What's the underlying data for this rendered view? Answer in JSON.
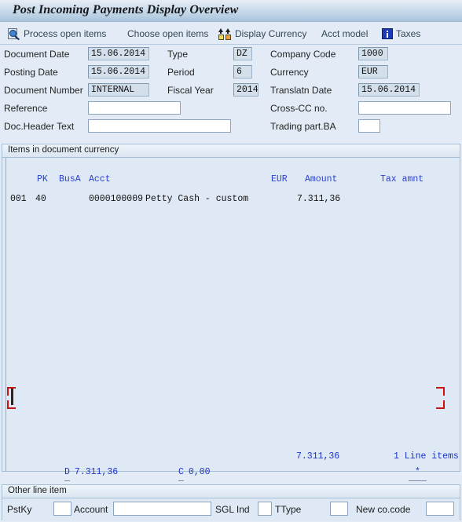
{
  "window": {
    "title": "Post Incoming Payments Display Overview"
  },
  "toolbar": {
    "items": [
      {
        "name": "process-open-items",
        "label": "Process open items",
        "icon": "search-document-icon"
      },
      {
        "name": "choose-open-items",
        "label": "Choose open items",
        "icon": ""
      },
      {
        "name": "display-currency",
        "label": "Display Currency",
        "icon": "two-squares-arrows-icon"
      },
      {
        "name": "acct-model",
        "label": "Acct model",
        "icon": ""
      },
      {
        "name": "taxes",
        "label": "Taxes",
        "icon": "info-icon"
      }
    ]
  },
  "header_form": {
    "document_date": {
      "label": "Document Date",
      "value": "15.06.2014"
    },
    "posting_date": {
      "label": "Posting Date",
      "value": "15.06.2014"
    },
    "document_number": {
      "label": "Document Number",
      "value": "INTERNAL"
    },
    "reference": {
      "label": "Reference",
      "value": "",
      "placeholder": ""
    },
    "doc_header_text": {
      "label": "Doc.Header Text",
      "value": "",
      "placeholder": ""
    },
    "type": {
      "label": "Type",
      "value": "DZ"
    },
    "period": {
      "label": "Period",
      "value": "6"
    },
    "fiscal_year": {
      "label": "Fiscal Year",
      "value": "2014"
    },
    "company_code": {
      "label": "Company Code",
      "value": "1000"
    },
    "currency": {
      "label": "Currency",
      "value": "EUR"
    },
    "translatn_date": {
      "label": "Translatn Date",
      "value": "15.06.2014"
    },
    "cross_cc_no": {
      "label": "Cross-CC no.",
      "value": "",
      "placeholder": ""
    },
    "trading_part_ba": {
      "label": "Trading part.BA",
      "value": "",
      "placeholder": ""
    }
  },
  "items_panel": {
    "title": "Items in document currency",
    "columns": {
      "itm": "",
      "pk": "PK",
      "busa": "BusA",
      "acct": "Acct",
      "curr": "EUR",
      "amount": "Amount",
      "tax": "Tax amnt"
    },
    "rows": [
      {
        "itm": "001",
        "pk": "40",
        "busa": "",
        "acct": "0000100009",
        "text": "Petty Cash - custom",
        "amount": "7.311,36",
        "tax": ""
      }
    ],
    "totals": {
      "debit_key": "D",
      "debit_value": "7.311,36",
      "credit_key": "C",
      "credit_value": "0,00",
      "balance_value": "7.311,36",
      "balance_key": "*",
      "line_items": "1 Line items"
    }
  },
  "other_line_item": {
    "title": "Other line item",
    "pstky": {
      "label": "PstKy",
      "value": ""
    },
    "account": {
      "label": "Account",
      "value": ""
    },
    "sgl_ind": {
      "label": "SGL Ind",
      "value": ""
    },
    "ttype": {
      "label": "TType",
      "value": ""
    },
    "new_co_code": {
      "label": "New co.code",
      "value": ""
    }
  },
  "colors": {
    "window_background": "#e3ecf6",
    "title_gradient_top": "#e6eef6",
    "title_gradient_bottom": "#a9c4dc",
    "grid_header_text": "#2a3fd0",
    "totals_text": "#1c34c8",
    "crop_marker": "#cc1111",
    "filled_field": "#d3dfeb"
  }
}
